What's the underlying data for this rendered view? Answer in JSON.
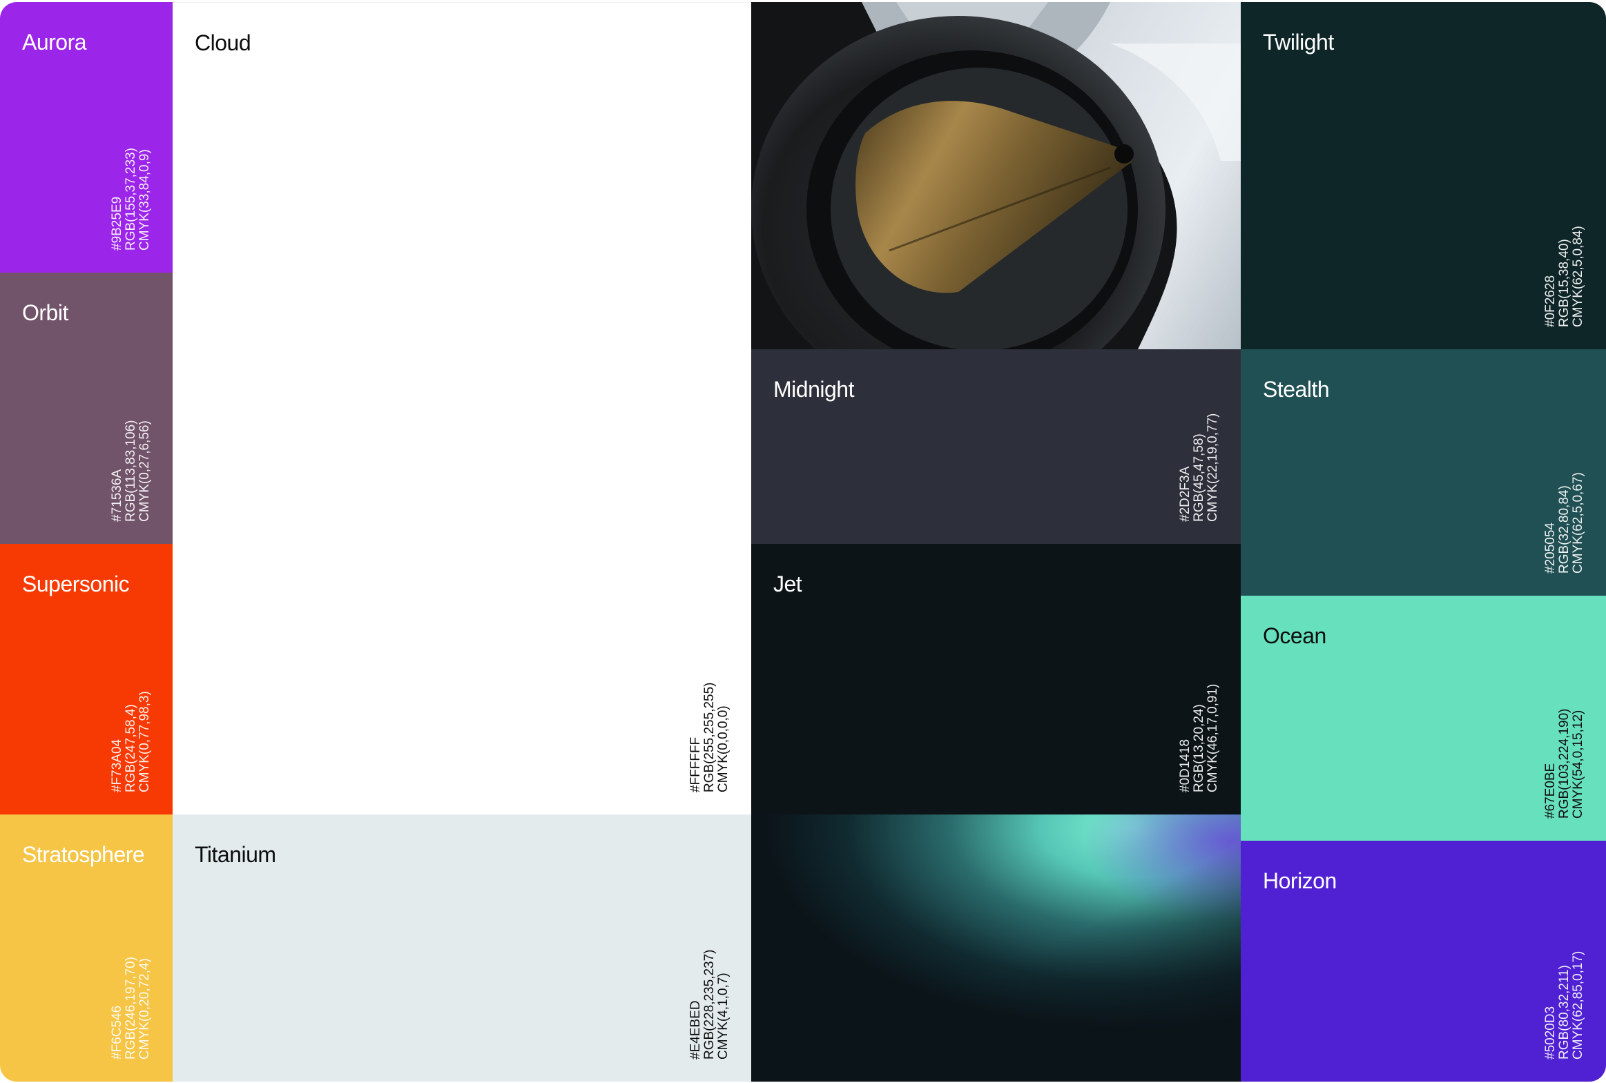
{
  "palette": {
    "aurora": {
      "name": "Aurora",
      "hex": "#9B25E9",
      "rgb": "RGB(155,37,233)",
      "cmyk": "CMYK(33,84,0,9)"
    },
    "orbit": {
      "name": "Orbit",
      "hex": "#71536A",
      "rgb": "RGB(113,83,106)",
      "cmyk": "CMYK(0,27,6,56)"
    },
    "supersonic": {
      "name": "Supersonic",
      "hex": "#F73A04",
      "rgb": "RGB(247,58,4)",
      "cmyk": "CMYK(0,77,98,3)"
    },
    "stratosphere": {
      "name": "Stratosphere",
      "hex": "#F6C546",
      "rgb": "RGB(246,197,70)",
      "cmyk": "CMYK(0,20,72,4)"
    },
    "cloud": {
      "name": "Cloud",
      "hex": "#FFFFFF",
      "rgb": "RGB(255,255,255)",
      "cmyk": "CMYK(0,0,0,0)"
    },
    "titanium": {
      "name": "Titanium",
      "hex": "#E4EBED",
      "rgb": "RGB(228,235,237)",
      "cmyk": "CMYK(4,1,0,7)"
    },
    "midnight": {
      "name": "Midnight",
      "hex": "#2D2F3A",
      "rgb": "RGB(45,47,58)",
      "cmyk": "CMYK(22,19,0,77)"
    },
    "jet": {
      "name": "Jet",
      "hex": "#0D1418",
      "rgb": "RGB(13,20,24)",
      "cmyk": "CMYK(46,17,0,91)"
    },
    "twilight": {
      "name": "Twilight",
      "hex": "#0F2628",
      "rgb": "RGB(15,38,40)",
      "cmyk": "CMYK(62,5,0,84)"
    },
    "stealth": {
      "name": "Stealth",
      "hex": "#205054",
      "rgb": "RGB(32,80,84)",
      "cmyk": "CMYK(62,5,0,67)"
    },
    "ocean": {
      "name": "Ocean",
      "hex": "#67E0BE",
      "rgb": "RGB(103,224,190)",
      "cmyk": "CMYK(54,0,15,12)"
    },
    "horizon": {
      "name": "Horizon",
      "hex": "#5020D3",
      "rgb": "RGB(80,32,211)",
      "cmyk": "CMYK(62,85,0,17)"
    }
  }
}
